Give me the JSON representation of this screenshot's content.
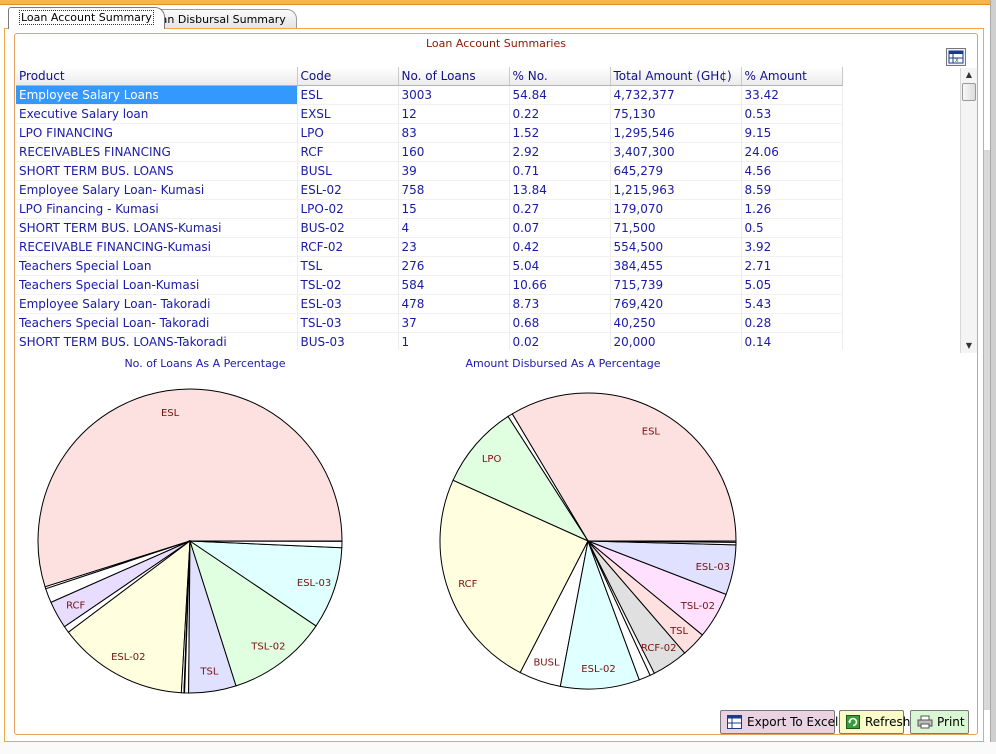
{
  "tabs": [
    {
      "label": "Loan Account Summary",
      "active": true
    },
    {
      "label": "Loan Disbursal Summary",
      "active": false
    }
  ],
  "group_title": "Loan Account Summaries",
  "grid": {
    "columns": [
      "Product",
      "Code",
      "No. of Loans",
      "% No.",
      "Total Amount (GH¢)",
      "% Amount"
    ],
    "rows": [
      {
        "product": "Employee Salary Loans",
        "code": "ESL",
        "loans": "3003",
        "pct_no": "54.84",
        "amount": "4,732,377",
        "pct_amount": "33.42",
        "selected": true
      },
      {
        "product": "Executive Salary loan",
        "code": "EXSL",
        "loans": "12",
        "pct_no": "0.22",
        "amount": "75,130",
        "pct_amount": "0.53"
      },
      {
        "product": "LPO FINANCING",
        "code": "LPO",
        "loans": "83",
        "pct_no": "1.52",
        "amount": "1,295,546",
        "pct_amount": "9.15"
      },
      {
        "product": "RECEIVABLES FINANCING",
        "code": "RCF",
        "loans": "160",
        "pct_no": "2.92",
        "amount": "3,407,300",
        "pct_amount": "24.06"
      },
      {
        "product": "SHORT TERM BUS. LOANS",
        "code": "BUSL",
        "loans": "39",
        "pct_no": "0.71",
        "amount": "645,279",
        "pct_amount": "4.56"
      },
      {
        "product": "Employee Salary Loan- Kumasi",
        "code": "ESL-02",
        "loans": "758",
        "pct_no": "13.84",
        "amount": "1,215,963",
        "pct_amount": "8.59"
      },
      {
        "product": "LPO Financing - Kumasi",
        "code": "LPO-02",
        "loans": "15",
        "pct_no": "0.27",
        "amount": "179,070",
        "pct_amount": "1.26"
      },
      {
        "product": "SHORT TERM BUS. LOANS-Kumasi",
        "code": "BUS-02",
        "loans": "4",
        "pct_no": "0.07",
        "amount": "71,500",
        "pct_amount": "0.5"
      },
      {
        "product": "RECEIVABLE FINANCING-Kumasi",
        "code": "RCF-02",
        "loans": "23",
        "pct_no": "0.42",
        "amount": "554,500",
        "pct_amount": "3.92"
      },
      {
        "product": "Teachers Special Loan",
        "code": "TSL",
        "loans": "276",
        "pct_no": "5.04",
        "amount": "384,455",
        "pct_amount": "2.71"
      },
      {
        "product": "Teachers Special Loan-Kumasi",
        "code": "TSL-02",
        "loans": "584",
        "pct_no": "10.66",
        "amount": "715,739",
        "pct_amount": "5.05"
      },
      {
        "product": "Employee Salary Loan- Takoradi",
        "code": "ESL-03",
        "loans": "478",
        "pct_no": "8.73",
        "amount": "769,420",
        "pct_amount": "5.43"
      },
      {
        "product": "Teachers Special Loan- Takoradi",
        "code": "TSL-03",
        "loans": "37",
        "pct_no": "0.68",
        "amount": "40,250",
        "pct_amount": "0.28"
      },
      {
        "product": "SHORT TERM BUS. LOANS-Takoradi",
        "code": "BUS-03",
        "loans": "1",
        "pct_no": "0.02",
        "amount": "20,000",
        "pct_amount": "0.14"
      }
    ]
  },
  "chart_data": [
    {
      "type": "pie",
      "title": "No. of Loans As A Percentage",
      "labels": [
        "ESL",
        "EXSL",
        "LPO",
        "RCF",
        "BUSL",
        "ESL-02",
        "LPO-02",
        "BUS-02",
        "RCF-02",
        "TSL",
        "TSL-02",
        "ESL-03",
        "TSL-03",
        "BUS-03"
      ],
      "values": [
        54.84,
        0.22,
        1.52,
        2.92,
        0.71,
        13.84,
        0.27,
        0.07,
        0.42,
        5.04,
        10.66,
        8.73,
        0.68,
        0.02
      ],
      "shown_labels": [
        "ESL",
        "ESL-02",
        "TSL-02",
        "ESL-03",
        "TSL",
        "RCF"
      ],
      "colors": [
        "#fde0e0",
        "#ffffff",
        "#ffffff",
        "#e8dcff",
        "#ffffff",
        "#ffffe0",
        "#ffffff",
        "#ffffff",
        "#ffffff",
        "#e0e0ff",
        "#e0ffe0",
        "#e0ffff",
        "#ffffff",
        "#ffffff"
      ]
    },
    {
      "type": "pie",
      "title": "Amount Disbursed As A Percentage",
      "labels": [
        "ESL",
        "EXSL",
        "LPO",
        "RCF",
        "BUSL",
        "ESL-02",
        "LPO-02",
        "BUS-02",
        "RCF-02",
        "TSL",
        "TSL-02",
        "ESL-03",
        "TSL-03",
        "BUS-03"
      ],
      "values": [
        33.42,
        0.53,
        9.15,
        24.06,
        4.56,
        8.59,
        1.26,
        0.5,
        3.92,
        2.71,
        5.05,
        5.43,
        0.28,
        0.14
      ],
      "shown_labels": [
        "ESL",
        "RCF",
        "LPO",
        "ESL-02",
        "ESL-03",
        "TSL-02",
        "BUSL",
        "RCF-02",
        "TSL"
      ],
      "colors": [
        "#fde0e0",
        "#ffffff",
        "#e0ffe0",
        "#ffffe0",
        "#ffffff",
        "#e0ffff",
        "#ffffff",
        "#ffffff",
        "#e0e0e0",
        "#ffe0e0",
        "#ffe0ff",
        "#e0e0ff",
        "#ffffff",
        "#ffffff"
      ]
    }
  ],
  "buttons": {
    "export_label": "Export To Excel",
    "refresh_label": "Refresh",
    "print_label": "Print"
  }
}
